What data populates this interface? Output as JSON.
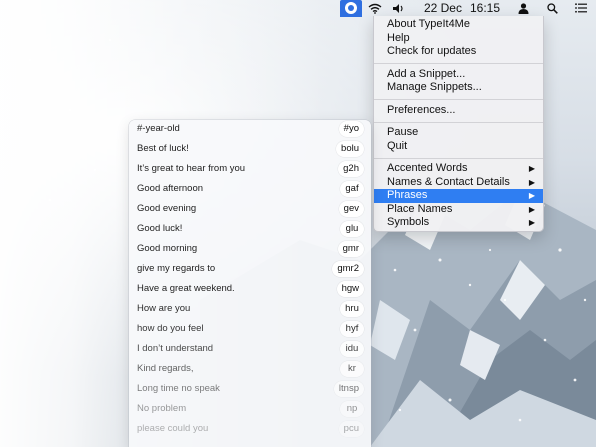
{
  "menubar": {
    "date": "22 Dec",
    "time": "16:15",
    "icons": [
      "typeit4me-icon",
      "wifi-icon",
      "volume-icon",
      "user-icon",
      "search-icon",
      "list-icon"
    ],
    "accent": "#2f6fe0"
  },
  "menu": {
    "items": [
      {
        "label": "About TypeIt4Me"
      },
      {
        "label": "Help"
      },
      {
        "label": "Check for updates"
      },
      {
        "label": "Add a Snippet..."
      },
      {
        "label": "Manage Snippets..."
      },
      {
        "label": "Preferences..."
      },
      {
        "label": "Pause"
      },
      {
        "label": "Quit"
      },
      {
        "label": "Accented Words",
        "submenu": true
      },
      {
        "label": "Names & Contact Details",
        "submenu": true
      },
      {
        "label": "Phrases",
        "submenu": true,
        "highlighted": true
      },
      {
        "label": "Place Names",
        "submenu": true
      },
      {
        "label": "Symbols",
        "submenu": true
      }
    ],
    "highlight_color": "#2f7ef2"
  },
  "snippets": [
    {
      "label": "#-year-old",
      "abbr": "#yo"
    },
    {
      "label": "Best of luck!",
      "abbr": "bolu"
    },
    {
      "label": "It’s great to hear from you",
      "abbr": "g2h"
    },
    {
      "label": "Good afternoon",
      "abbr": "gaf"
    },
    {
      "label": "Good evening",
      "abbr": "gev"
    },
    {
      "label": "Good luck!",
      "abbr": "glu"
    },
    {
      "label": "Good morning",
      "abbr": "gmr"
    },
    {
      "label": "give my regards to",
      "abbr": "gmr2"
    },
    {
      "label": "Have a great weekend.",
      "abbr": "hgw"
    },
    {
      "label": "How are you",
      "abbr": "hru"
    },
    {
      "label": "how do you feel",
      "abbr": "hyf"
    },
    {
      "label": "I don’t understand",
      "abbr": "idu"
    },
    {
      "label": "Kind regards,",
      "abbr": "kr"
    },
    {
      "label": "Long time no speak",
      "abbr": "ltnsp"
    },
    {
      "label": "No problem",
      "abbr": "np"
    },
    {
      "label": "please could you",
      "abbr": "pcu"
    }
  ]
}
